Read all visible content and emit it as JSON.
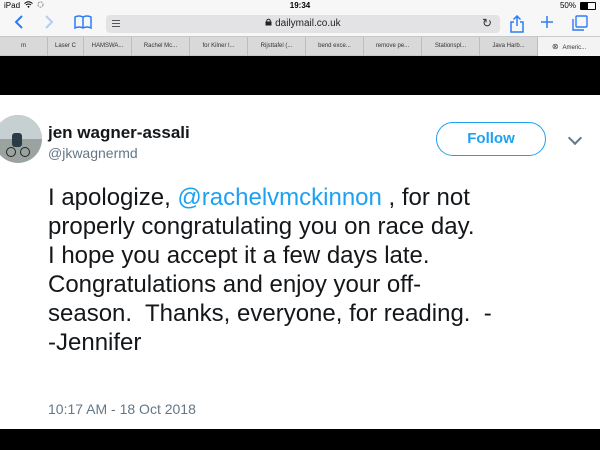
{
  "status_bar": {
    "device": "iPad",
    "time": "19:34",
    "battery_text": "50%",
    "battery_level": 0.5
  },
  "toolbar": {
    "back_icon": "chevron-left-icon",
    "forward_icon": "chevron-right-icon",
    "bookmarks_icon": "book-icon",
    "url": "dailymail.co.uk"
  },
  "tabs": [
    "m",
    "Laser C",
    "HAMSWA...",
    "Rachel Mc...",
    "for Kilner l...",
    "Rijsttafel (...",
    "bend exce...",
    "remove pe...",
    "Stationspl...",
    "Java Harb...",
    "Americ..."
  ],
  "tweet": {
    "name": "jen wagner-assali",
    "handle": "@jkwagnermd",
    "follow_label": "Follow",
    "text_line1_prefix": "I apologize, ",
    "text_line1_mention": "@rachelvmckinnon",
    "text_line1_suffix": " , for not",
    "text_line2": "properly congratulating you on race day.",
    "text_line3": "I hope you accept it a few days late.",
    "text_line4": "Congratulations and enjoy your off-",
    "text_line5": "season.  Thanks, everyone, for reading.  -",
    "text_line6": "-Jennifer",
    "timestamp": "10:17 AM - 18 Oct 2018"
  },
  "colors": {
    "accent": "#1da1f2",
    "ios_blue": "#2d7cf6",
    "text": "#14171a",
    "muted": "#657786"
  }
}
